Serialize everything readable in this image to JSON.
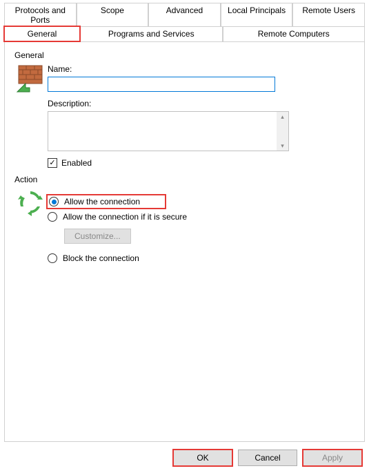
{
  "tabs": {
    "row1": [
      "Protocols and Ports",
      "Scope",
      "Advanced",
      "Local Principals",
      "Remote Users"
    ],
    "row2": [
      "General",
      "Programs and Services",
      "Remote Computers"
    ],
    "active": "General"
  },
  "general": {
    "group_label": "General",
    "name_label": "Name:",
    "name_value": "",
    "description_label": "Description:",
    "description_value": "",
    "enabled_label": "Enabled",
    "enabled_checked": true
  },
  "action": {
    "group_label": "Action",
    "allow_label": "Allow the connection",
    "allow_secure_label": "Allow the connection if it is secure",
    "block_label": "Block the connection",
    "customize_label": "Customize...",
    "selected": "allow"
  },
  "buttons": {
    "ok": "OK",
    "cancel": "Cancel",
    "apply": "Apply"
  }
}
